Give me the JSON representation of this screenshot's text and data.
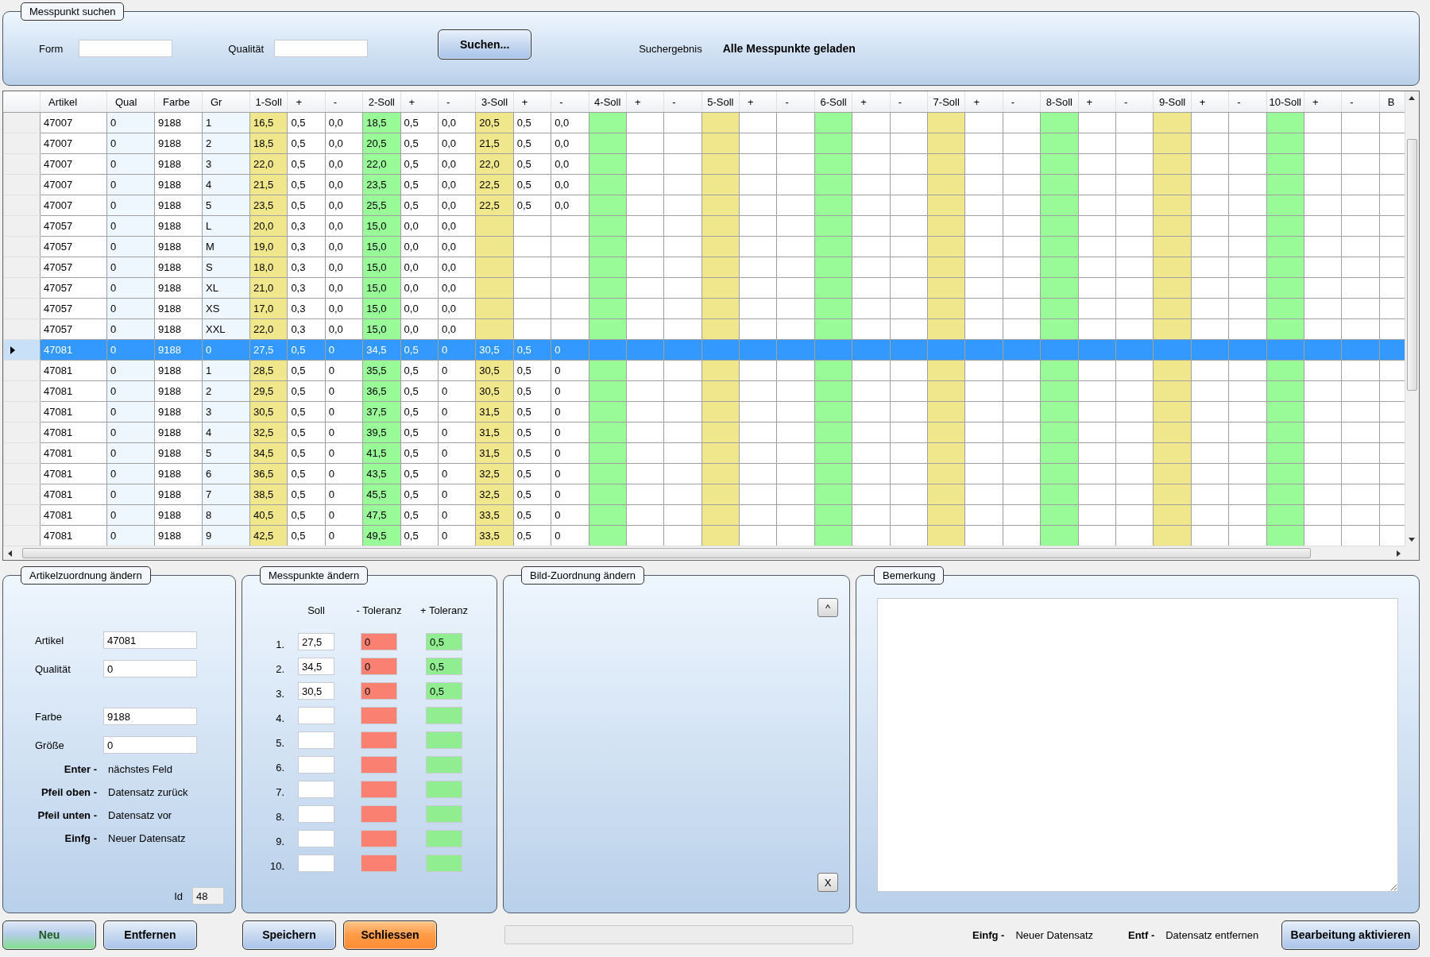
{
  "search": {
    "title": "Messpunkt suchen",
    "fields": [
      {
        "label": "Form"
      },
      {
        "label": "Qualität"
      }
    ],
    "button": "Suchen...",
    "result_label": "Suchergebnis",
    "result": "Alle Messpunkte geladen"
  },
  "grid": {
    "columns": [
      {
        "label": "Artikel"
      },
      {
        "label": "Qual",
        "color": "#eef6fe"
      },
      {
        "label": "Farbe"
      },
      {
        "label": "Gr",
        "color": "#eef6fe"
      },
      {
        "label": "1-Soll",
        "color": "#f0e68c"
      },
      {
        "label": "+"
      },
      {
        "label": "-"
      },
      {
        "label": "2-Soll",
        "color": "#98fb98"
      },
      {
        "label": "+"
      },
      {
        "label": "-"
      },
      {
        "label": "3-Soll",
        "color": "#f0e68c"
      },
      {
        "label": "+"
      },
      {
        "label": "-"
      },
      {
        "label": "4-Soll",
        "color": "#98fb98"
      },
      {
        "label": "+"
      },
      {
        "label": "-"
      },
      {
        "label": "5-Soll",
        "color": "#f0e68c"
      },
      {
        "label": "+"
      },
      {
        "label": "-"
      },
      {
        "label": "6-Soll",
        "color": "#98fb98"
      },
      {
        "label": "+"
      },
      {
        "label": "-"
      },
      {
        "label": "7-Soll",
        "color": "#f0e68c"
      },
      {
        "label": "+"
      },
      {
        "label": "-"
      },
      {
        "label": "8-Soll",
        "color": "#98fb98"
      },
      {
        "label": "+"
      },
      {
        "label": "-"
      },
      {
        "label": "9-Soll",
        "color": "#f0e68c"
      },
      {
        "label": "+"
      },
      {
        "label": "-"
      },
      {
        "label": "10-Soll",
        "color": "#98fb98"
      },
      {
        "label": "+"
      },
      {
        "label": "-"
      },
      {
        "label": "B"
      }
    ],
    "rows": [
      {
        "selected": false,
        "cells": [
          "47007",
          "0",
          "9188",
          "1",
          "16,5",
          "0,5",
          "0,0",
          "18,5",
          "0,5",
          "0,0",
          "20,5",
          "0,5",
          "0,0"
        ]
      },
      {
        "selected": false,
        "cells": [
          "47007",
          "0",
          "9188",
          "2",
          "18,5",
          "0,5",
          "0,0",
          "20,5",
          "0,5",
          "0,0",
          "21,5",
          "0,5",
          "0,0"
        ]
      },
      {
        "selected": false,
        "cells": [
          "47007",
          "0",
          "9188",
          "3",
          "22,0",
          "0,5",
          "0,0",
          "22,0",
          "0,5",
          "0,0",
          "22,0",
          "0,5",
          "0,0"
        ]
      },
      {
        "selected": false,
        "cells": [
          "47007",
          "0",
          "9188",
          "4",
          "21,5",
          "0,5",
          "0,0",
          "23,5",
          "0,5",
          "0,0",
          "22,5",
          "0,5",
          "0,0"
        ]
      },
      {
        "selected": false,
        "cells": [
          "47007",
          "0",
          "9188",
          "5",
          "23,5",
          "0,5",
          "0,0",
          "25,5",
          "0,5",
          "0,0",
          "22,5",
          "0,5",
          "0,0"
        ]
      },
      {
        "selected": false,
        "cells": [
          "47057",
          "0",
          "9188",
          "L",
          "20,0",
          "0,3",
          "0,0",
          "15,0",
          "0,0",
          "0,0"
        ]
      },
      {
        "selected": false,
        "cells": [
          "47057",
          "0",
          "9188",
          "M",
          "19,0",
          "0,3",
          "0,0",
          "15,0",
          "0,0",
          "0,0"
        ]
      },
      {
        "selected": false,
        "cells": [
          "47057",
          "0",
          "9188",
          "S",
          "18,0",
          "0,3",
          "0,0",
          "15,0",
          "0,0",
          "0,0"
        ]
      },
      {
        "selected": false,
        "cells": [
          "47057",
          "0",
          "9188",
          "XL",
          "21,0",
          "0,3",
          "0,0",
          "15,0",
          "0,0",
          "0,0"
        ]
      },
      {
        "selected": false,
        "cells": [
          "47057",
          "0",
          "9188",
          "XS",
          "17,0",
          "0,3",
          "0,0",
          "15,0",
          "0,0",
          "0,0"
        ]
      },
      {
        "selected": false,
        "cells": [
          "47057",
          "0",
          "9188",
          "XXL",
          "22,0",
          "0,3",
          "0,0",
          "15,0",
          "0,0",
          "0,0"
        ]
      },
      {
        "selected": true,
        "cells": [
          "47081",
          "0",
          "9188",
          "0",
          "27,5",
          "0,5",
          "0",
          "34,5",
          "0,5",
          "0",
          "30,5",
          "0,5",
          "0"
        ]
      },
      {
        "selected": false,
        "cells": [
          "47081",
          "0",
          "9188",
          "1",
          "28,5",
          "0,5",
          "0",
          "35,5",
          "0,5",
          "0",
          "30,5",
          "0,5",
          "0"
        ]
      },
      {
        "selected": false,
        "cells": [
          "47081",
          "0",
          "9188",
          "2",
          "29,5",
          "0,5",
          "0",
          "36,5",
          "0,5",
          "0",
          "30,5",
          "0,5",
          "0"
        ]
      },
      {
        "selected": false,
        "cells": [
          "47081",
          "0",
          "9188",
          "3",
          "30,5",
          "0,5",
          "0",
          "37,5",
          "0,5",
          "0",
          "31,5",
          "0,5",
          "0"
        ]
      },
      {
        "selected": false,
        "cells": [
          "47081",
          "0",
          "9188",
          "4",
          "32,5",
          "0,5",
          "0",
          "39,5",
          "0,5",
          "0",
          "31,5",
          "0,5",
          "0"
        ]
      },
      {
        "selected": false,
        "cells": [
          "47081",
          "0",
          "9188",
          "5",
          "34,5",
          "0,5",
          "0",
          "41,5",
          "0,5",
          "0",
          "31,5",
          "0,5",
          "0"
        ]
      },
      {
        "selected": false,
        "cells": [
          "47081",
          "0",
          "9188",
          "6",
          "36,5",
          "0,5",
          "0",
          "43,5",
          "0,5",
          "0",
          "32,5",
          "0,5",
          "0"
        ]
      },
      {
        "selected": false,
        "cells": [
          "47081",
          "0",
          "9188",
          "7",
          "38,5",
          "0,5",
          "0",
          "45,5",
          "0,5",
          "0",
          "32,5",
          "0,5",
          "0"
        ]
      },
      {
        "selected": false,
        "cells": [
          "47081",
          "0",
          "9188",
          "8",
          "40,5",
          "0,5",
          "0",
          "47,5",
          "0,5",
          "0",
          "33,5",
          "0,5",
          "0"
        ]
      },
      {
        "selected": false,
        "cells": [
          "47081",
          "0",
          "9188",
          "9",
          "42,5",
          "0,5",
          "0",
          "49,5",
          "0,5",
          "0",
          "33,5",
          "0,5",
          "0"
        ]
      }
    ]
  },
  "article_panel": {
    "title": "Artikelzuordnung ändern",
    "fields": [
      {
        "label": "Artikel",
        "value": "47081"
      },
      {
        "label": "Qualität",
        "value": "0"
      },
      {
        "label": "Farbe",
        "value": "9188"
      },
      {
        "label": "Größe",
        "value": "0"
      }
    ],
    "shortcuts": [
      {
        "key": "Enter -",
        "text": "nächstes Feld"
      },
      {
        "key": "Pfeil oben -",
        "text": "Datensatz zurück"
      },
      {
        "key": "Pfeil unten -",
        "text": "Datensatz vor"
      },
      {
        "key": "Einfg -",
        "text": "Neuer Datensatz"
      }
    ],
    "id_label": "Id",
    "id_value": "48"
  },
  "points_panel": {
    "title": "Messpunkte ändern",
    "columns": [
      {
        "label": "Soll"
      },
      {
        "label": "- Toleranz",
        "color": "#fa8072"
      },
      {
        "label": "+ Toleranz",
        "color": "#90ee90"
      }
    ],
    "rows": [
      {
        "number": "1.",
        "values": [
          "27,5",
          "0",
          "0,5"
        ]
      },
      {
        "number": "2.",
        "values": [
          "34,5",
          "0",
          "0,5"
        ]
      },
      {
        "number": "3.",
        "values": [
          "30,5",
          "0",
          "0,5"
        ]
      },
      {
        "number": "4."
      },
      {
        "number": "5."
      },
      {
        "number": "6."
      },
      {
        "number": "7."
      },
      {
        "number": "8."
      },
      {
        "number": "9."
      },
      {
        "number": "10."
      }
    ]
  },
  "image_panel": {
    "title": "Bild-Zuordnung ändern",
    "up_button": "^",
    "remove_button": "X"
  },
  "remark_panel": {
    "title": "Bemerkung"
  },
  "buttons_left": [
    {
      "label": "Neu",
      "kind": "confirm"
    },
    {
      "label": "Entfernen",
      "kind": "normal"
    }
  ],
  "buttons_mid": [
    {
      "label": "Speichern",
      "kind": "normal"
    },
    {
      "label": "Schliessen",
      "kind": "warning"
    }
  ],
  "progress": {
    "level": 0
  },
  "footer_shortcuts": [
    {
      "key": "Einfg -",
      "text": "Neuer Datensatz"
    },
    {
      "key": "Entf -",
      "text": "Datensatz entfernen"
    }
  ],
  "edit_button": {
    "label": "Bearbeitung aktivieren",
    "kind": "normal"
  }
}
